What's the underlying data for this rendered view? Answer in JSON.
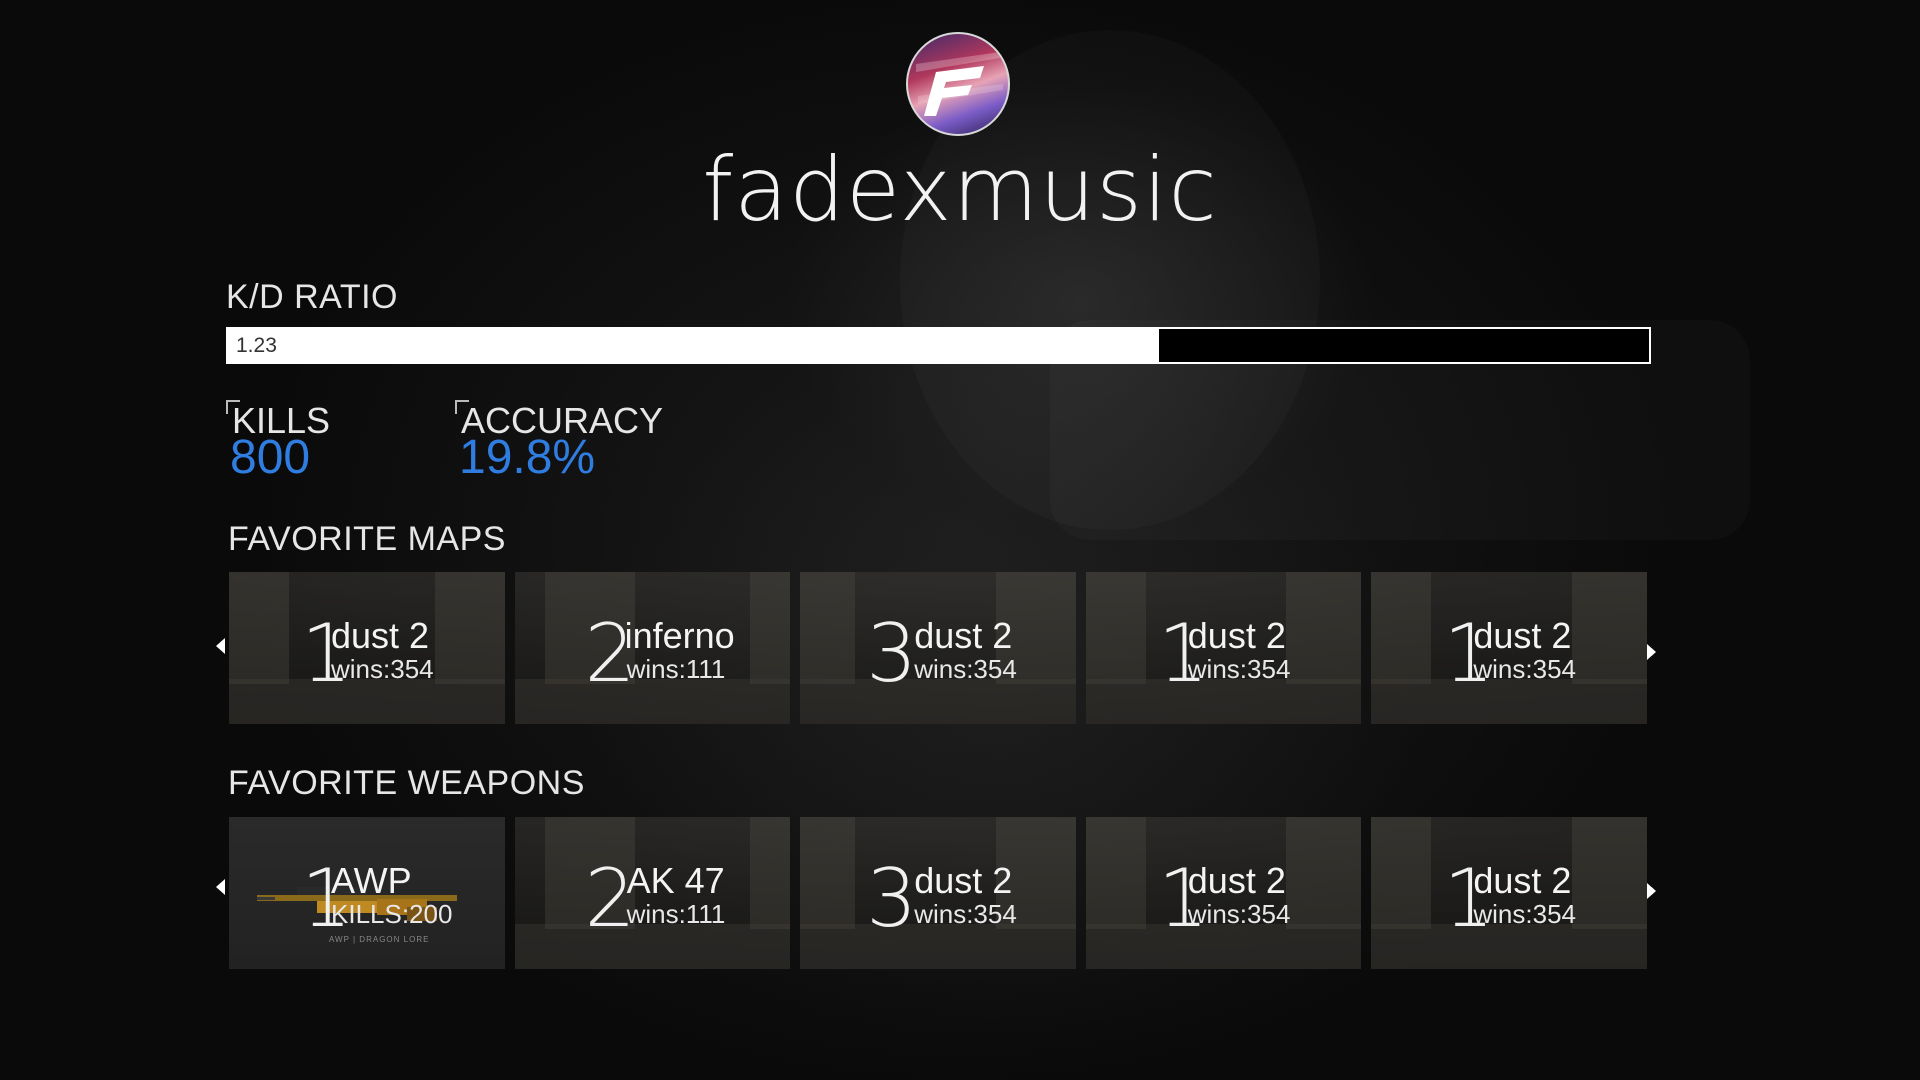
{
  "profile": {
    "username": "fadexmusic"
  },
  "kd": {
    "label": "K/D RATIO",
    "value_text": "1.23",
    "fill_fraction": 0.655
  },
  "stats": {
    "kills": {
      "label": "KILLS",
      "value": "800"
    },
    "accuracy": {
      "label": "ACCURACY",
      "value": "19.8%"
    }
  },
  "maps": {
    "title": "FAVORITE MAPS",
    "items": [
      {
        "rank": "1",
        "name": "dust 2",
        "sub": "wins:354"
      },
      {
        "rank": "2",
        "name": "inferno",
        "sub": "wins:111"
      },
      {
        "rank": "3",
        "name": "dust 2",
        "sub": "wins:354"
      },
      {
        "rank": "1",
        "name": "dust 2",
        "sub": "wins:354"
      },
      {
        "rank": "1",
        "name": "dust 2",
        "sub": "wins:354"
      }
    ]
  },
  "weapons": {
    "title": "FAVORITE WEAPONS",
    "items": [
      {
        "rank": "1",
        "name": "AWP",
        "sub": "KILLS:200",
        "caption": "AWP | DRAGON LORE"
      },
      {
        "rank": "2",
        "name": "AK 47",
        "sub": "wins:111"
      },
      {
        "rank": "3",
        "name": "dust 2",
        "sub": "wins:354"
      },
      {
        "rank": "1",
        "name": "dust 2",
        "sub": "wins:354"
      },
      {
        "rank": "1",
        "name": "dust 2",
        "sub": "wins:354"
      }
    ]
  },
  "colors": {
    "accent": "#2f7de1",
    "background": "#0d0d0d",
    "text": "#ffffff"
  },
  "icons": {
    "avatar": "fadex-logo-icon",
    "prev": "chevron-left-icon",
    "next": "chevron-right-icon"
  }
}
